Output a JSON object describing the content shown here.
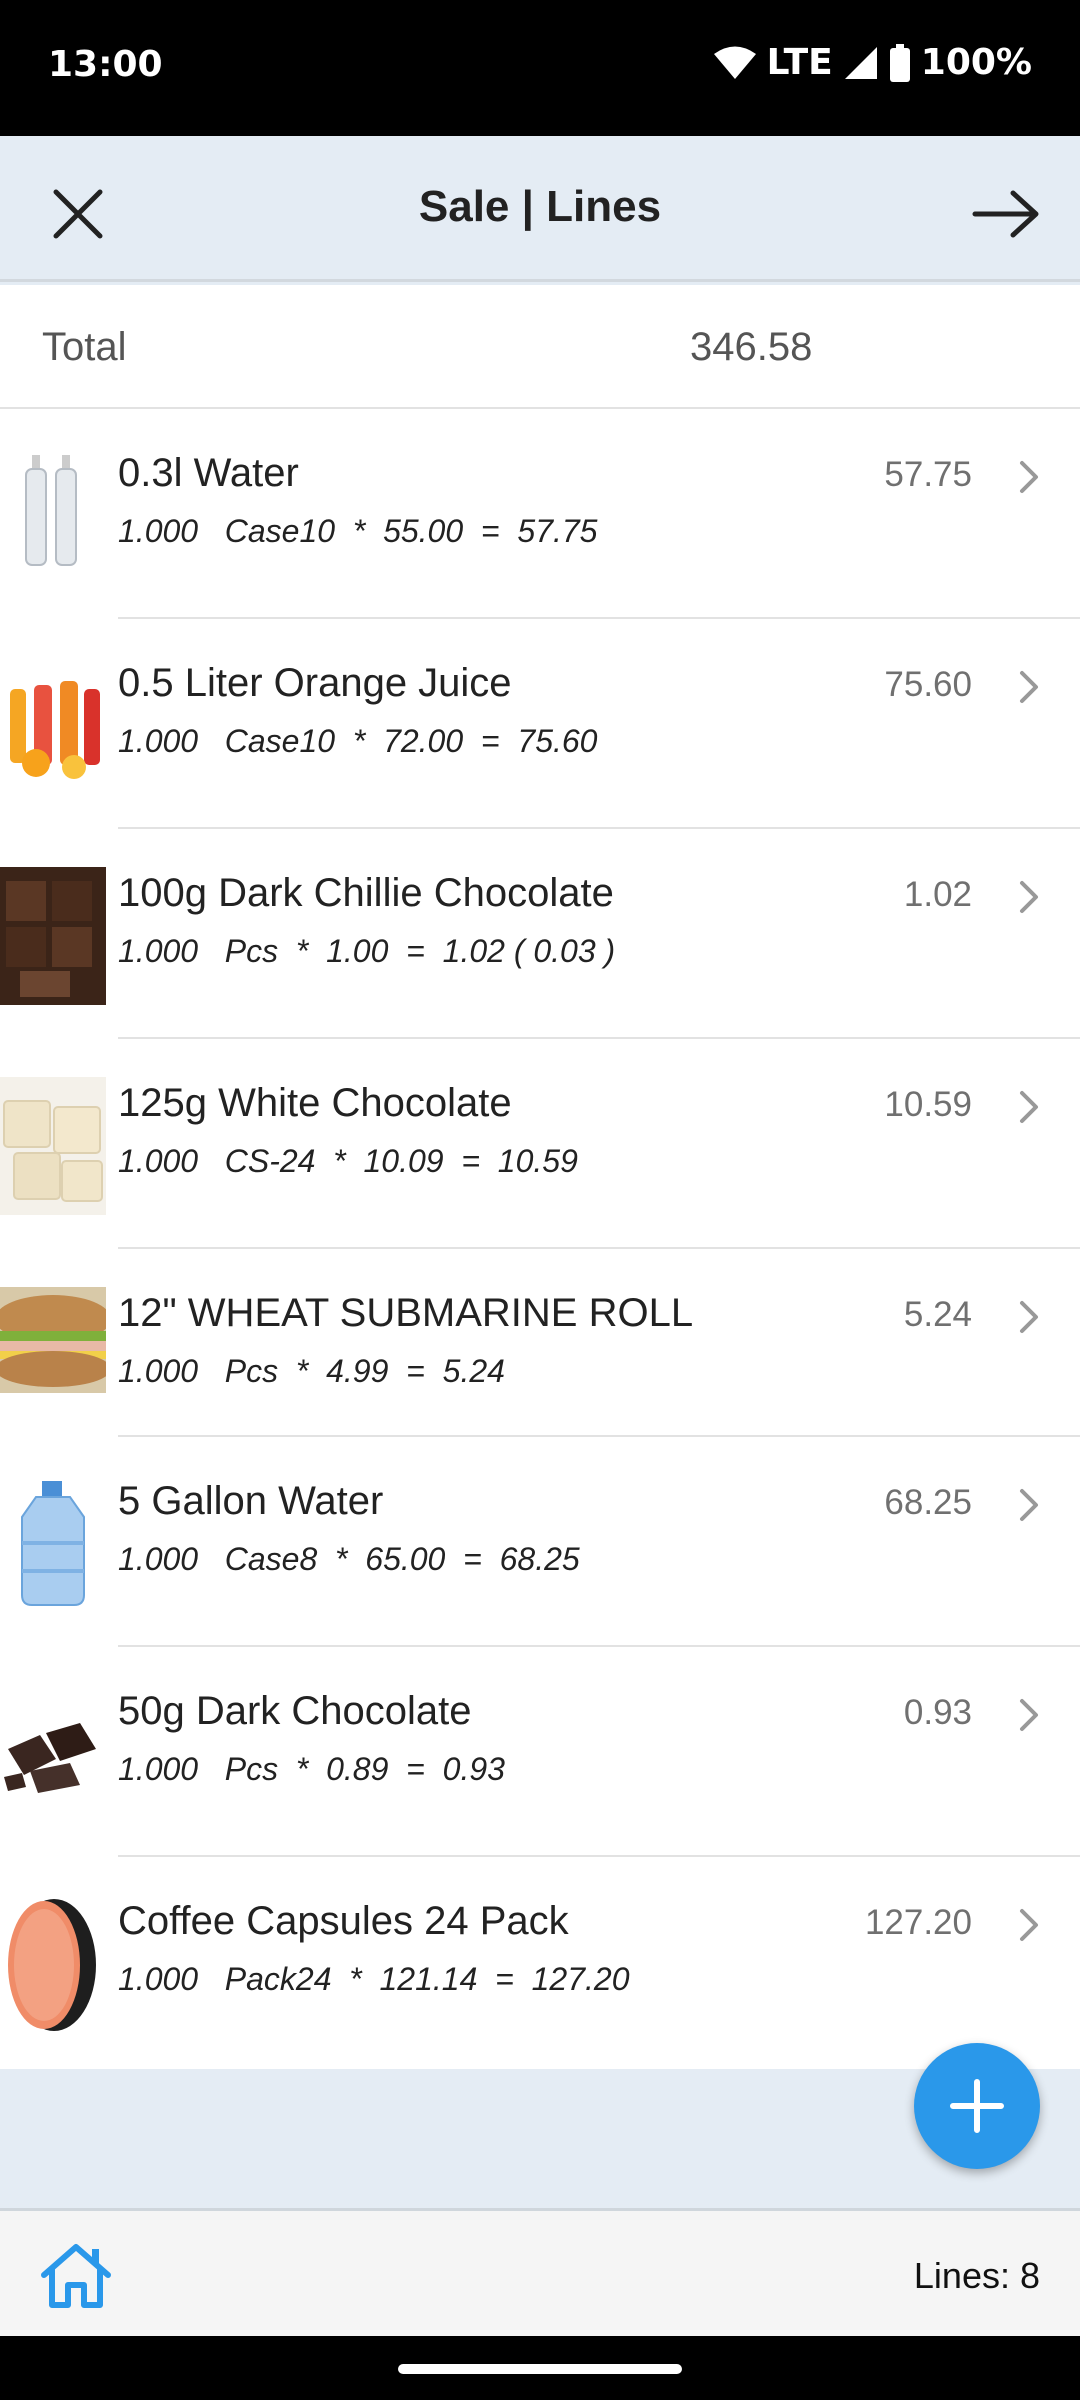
{
  "status_bar": {
    "time": "13:00",
    "network": "LTE",
    "battery": "100%"
  },
  "header": {
    "title": "Sale | Lines",
    "close_icon": "close-icon",
    "next_icon": "arrow-right-icon"
  },
  "summary": {
    "total_label": "Total",
    "total_value": "346.58"
  },
  "lines": [
    {
      "name": "0.3l Water",
      "calc": "1.000   Case10  *  55.00  =  57.75",
      "amount": "57.75",
      "image": "water-bottles"
    },
    {
      "name": "0.5 Liter Orange Juice",
      "calc": "1.000   Case10  *  72.00  =  75.60",
      "amount": "75.60",
      "image": "juice-bottles"
    },
    {
      "name": "100g Dark Chillie Chocolate",
      "calc": "1.000   Pcs  *  1.00  =  1.02 ( 0.03 )",
      "amount": "1.02",
      "image": "dark-chocolate"
    },
    {
      "name": "125g White Chocolate",
      "calc": "1.000   CS-24  *  10.09  =  10.59",
      "amount": "10.59",
      "image": "white-chocolate"
    },
    {
      "name": "12\" WHEAT SUBMARINE ROLL",
      "calc": "1.000   Pcs  *  4.99  =  5.24",
      "amount": "5.24",
      "image": "submarine-sandwich"
    },
    {
      "name": "5 Gallon Water",
      "calc": "1.000   Case8  *  65.00  =  68.25",
      "amount": "68.25",
      "image": "water-jug"
    },
    {
      "name": "50g Dark Chocolate",
      "calc": "1.000   Pcs  *  0.89  =  0.93",
      "amount": "0.93",
      "image": "chocolate-pieces"
    },
    {
      "name": "Coffee Capsules 24 Pack",
      "calc": "1.000   Pack24  *  121.14  =  127.20",
      "amount": "127.20",
      "image": "coffee-capsule"
    }
  ],
  "footer": {
    "lines_label": "Lines: 8",
    "home_icon": "home-icon",
    "add_icon": "plus-icon"
  },
  "colors": {
    "accent": "#2a98ea",
    "app_bar": "#e4ecf4",
    "amount_text": "#707070"
  }
}
